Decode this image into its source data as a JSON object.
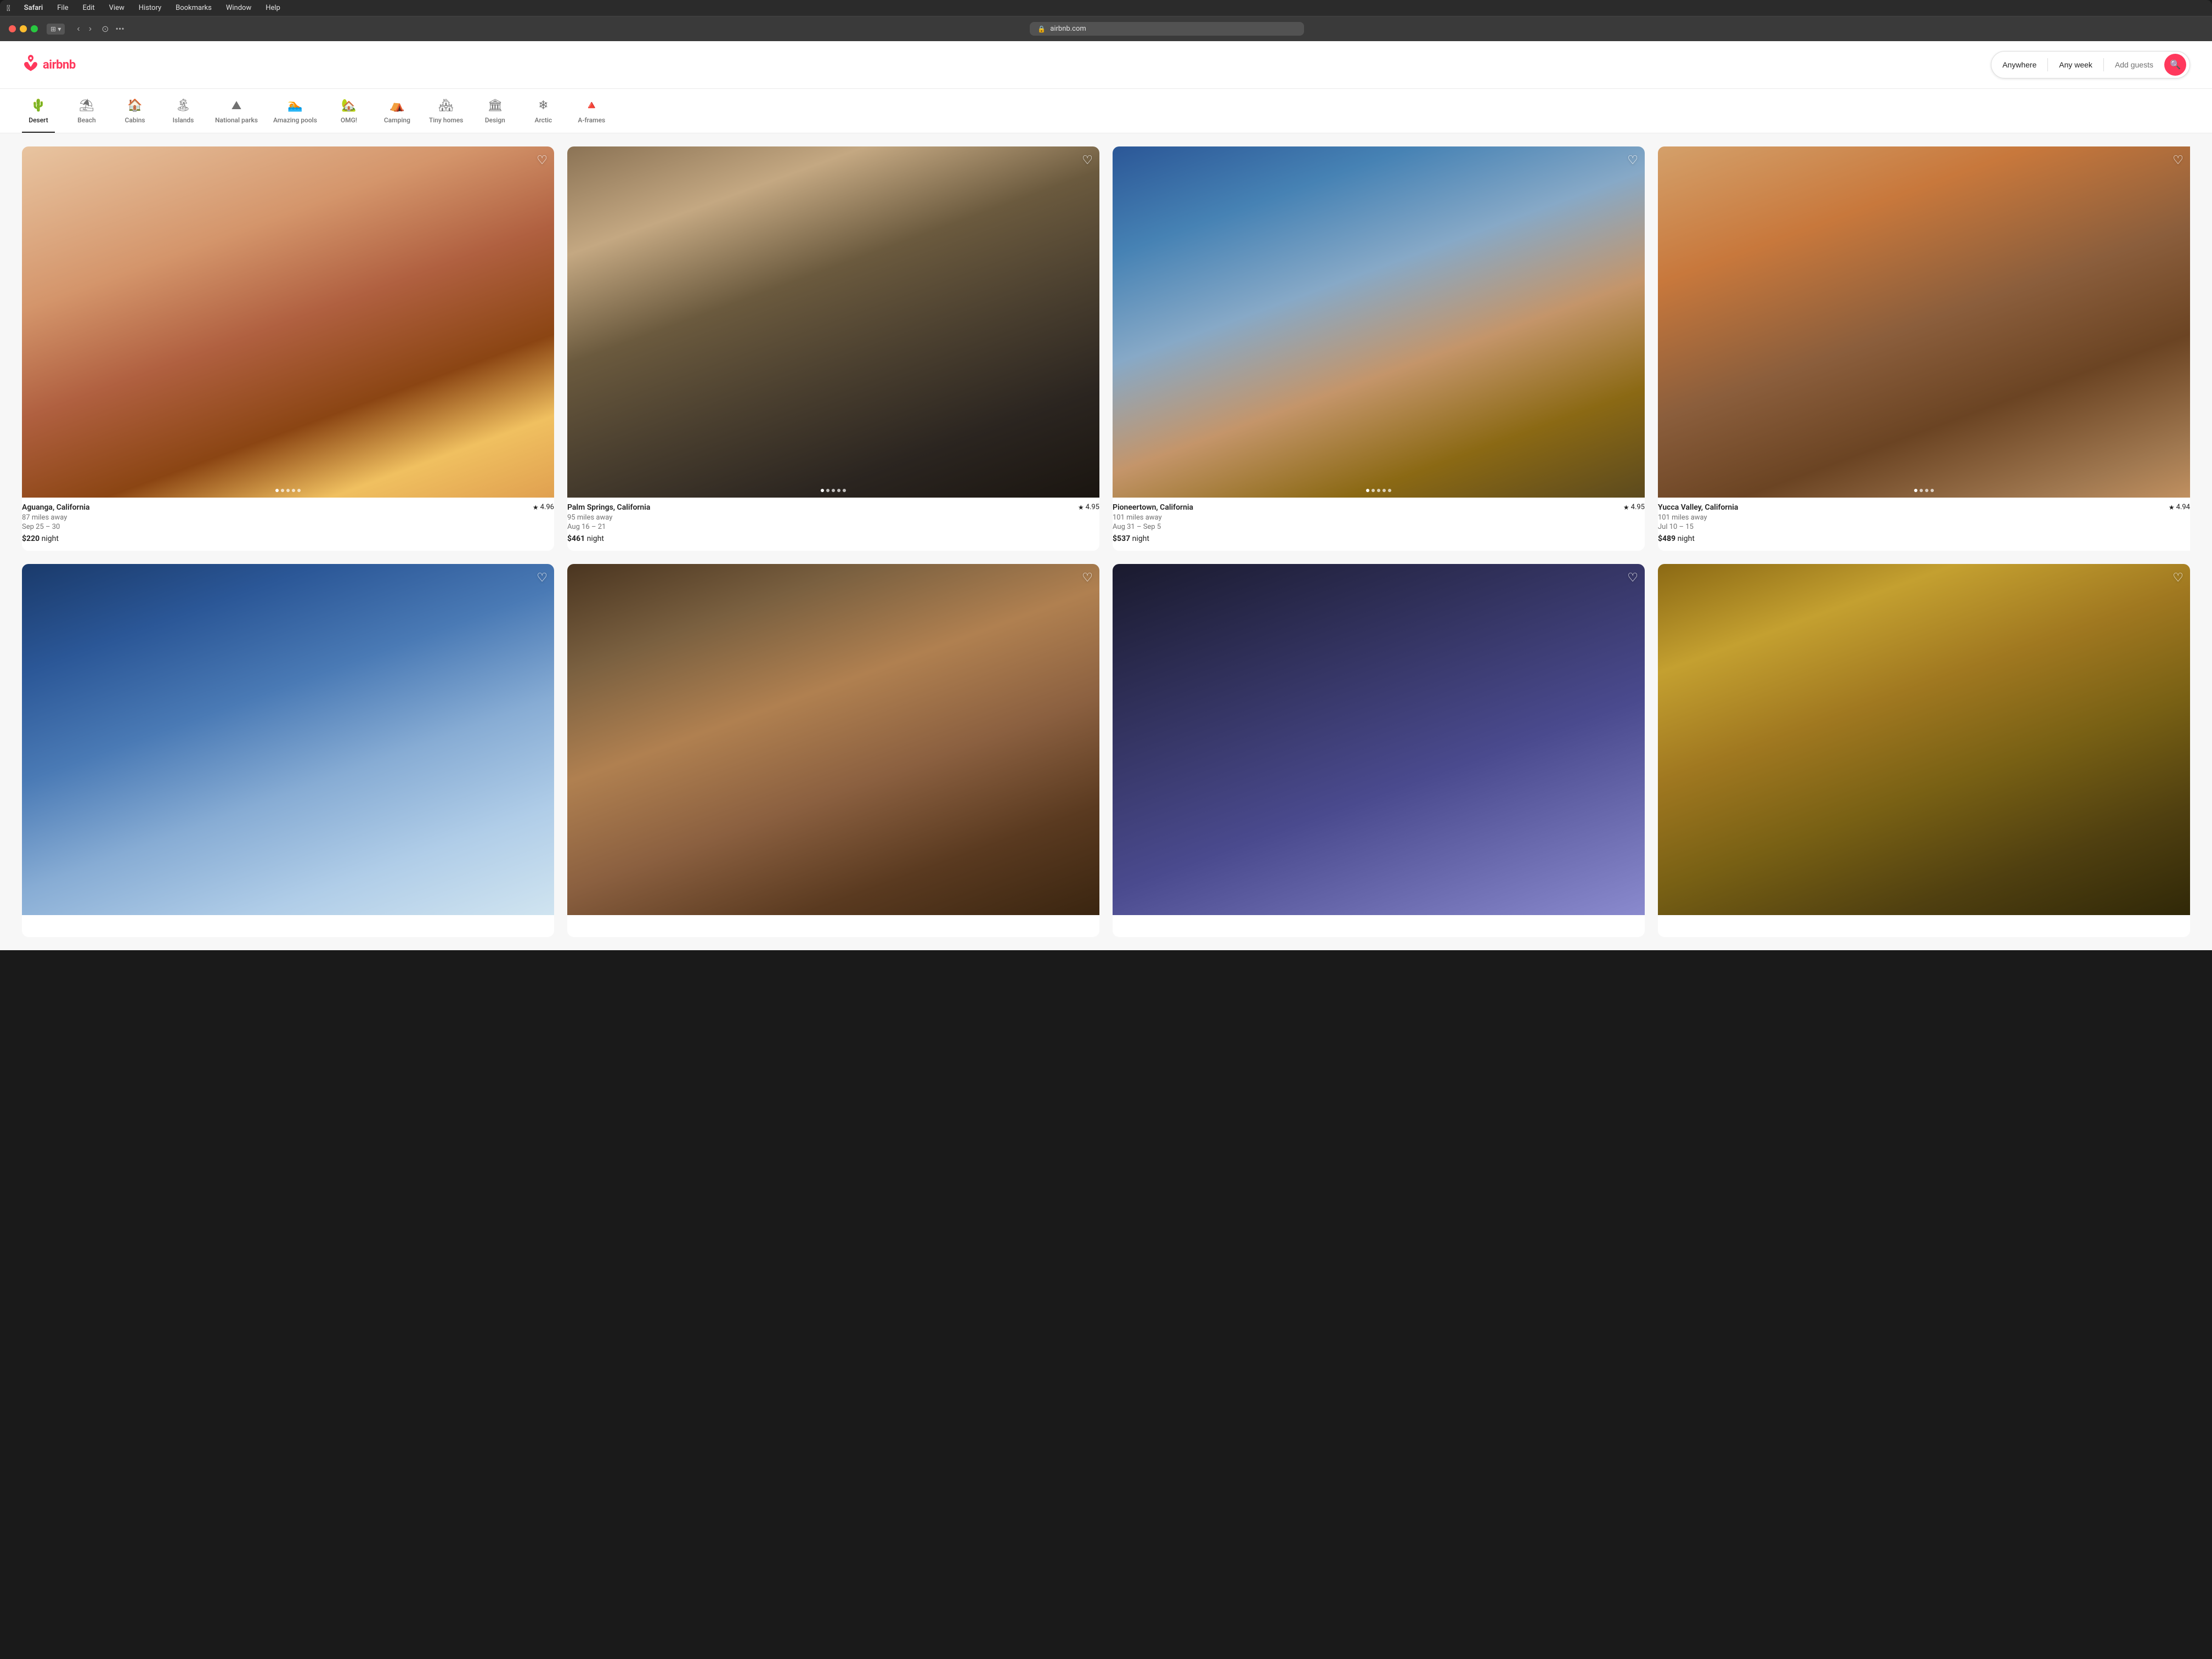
{
  "browser": {
    "menu_items": [
      "Safari",
      "File",
      "Edit",
      "View",
      "History",
      "Bookmarks",
      "Window",
      "Help"
    ],
    "url": "airbnb.com",
    "privacy_icon": "🔒"
  },
  "header": {
    "logo_text": "airbnb",
    "logo_icon": "⬡",
    "search": {
      "anywhere_label": "Anywhere",
      "any_week_label": "Any week",
      "add_guests_label": "Add guests",
      "search_icon": "🔍"
    }
  },
  "categories": [
    {
      "id": "desert",
      "label": "Desert",
      "icon": "🌵",
      "active": true
    },
    {
      "id": "beach",
      "label": "Beach",
      "icon": "⛱",
      "active": false
    },
    {
      "id": "cabins",
      "label": "Cabins",
      "icon": "🏠",
      "active": false
    },
    {
      "id": "islands",
      "label": "Islands",
      "icon": "🏝",
      "active": false
    },
    {
      "id": "national-parks",
      "label": "National parks",
      "icon": "⛰",
      "active": false
    },
    {
      "id": "amazing-pools",
      "label": "Amazing pools",
      "icon": "🏊",
      "active": false
    },
    {
      "id": "omg",
      "label": "OMG!",
      "icon": "🏡",
      "active": false
    },
    {
      "id": "camping",
      "label": "Camping",
      "icon": "⛺",
      "active": false
    },
    {
      "id": "tiny-homes",
      "label": "Tiny homes",
      "icon": "🏘",
      "active": false
    },
    {
      "id": "design",
      "label": "Design",
      "icon": "🏛",
      "active": false
    },
    {
      "id": "arctic",
      "label": "Arctic",
      "icon": "❄",
      "active": false
    },
    {
      "id": "a-frames",
      "label": "A-frames",
      "icon": "🔺",
      "active": false
    }
  ],
  "listings": [
    {
      "id": 1,
      "location": "Aguanga, California",
      "rating": "4.96",
      "distance": "87 miles away",
      "dates": "Sep 25 – 30",
      "price": "$220",
      "price_unit": "night",
      "img_class": "img-aguanga",
      "dots": 5,
      "active_dot": 0
    },
    {
      "id": 2,
      "location": "Palm Springs, California",
      "rating": "4.95",
      "distance": "95 miles away",
      "dates": "Aug 16 – 21",
      "price": "$461",
      "price_unit": "night",
      "img_class": "img-palmsprings",
      "dots": 5,
      "active_dot": 0
    },
    {
      "id": 3,
      "location": "Pioneertown, California",
      "rating": "4.95",
      "distance": "101 miles away",
      "dates": "Aug 31 – Sep 5",
      "price": "$537",
      "price_unit": "night",
      "img_class": "img-pioneertown",
      "dots": 5,
      "active_dot": 0
    },
    {
      "id": 4,
      "location": "Yucca Valley, California",
      "rating": "4.94",
      "distance": "101 miles away",
      "dates": "Jul 10 – 15",
      "price": "$489",
      "price_unit": "night",
      "img_class": "img-yucca",
      "dots": 4,
      "active_dot": 0
    }
  ],
  "bottom_listings": [
    {
      "id": 5,
      "img_class": "img-bottom1"
    },
    {
      "id": 6,
      "img_class": "img-bottom2"
    },
    {
      "id": 7,
      "img_class": "img-bottom3"
    },
    {
      "id": 8,
      "img_class": "img-bottom4"
    }
  ],
  "labels": {
    "night": "night",
    "heart": "♡",
    "star": "★",
    "back": "‹",
    "forward": "›",
    "lock": "🔒"
  }
}
